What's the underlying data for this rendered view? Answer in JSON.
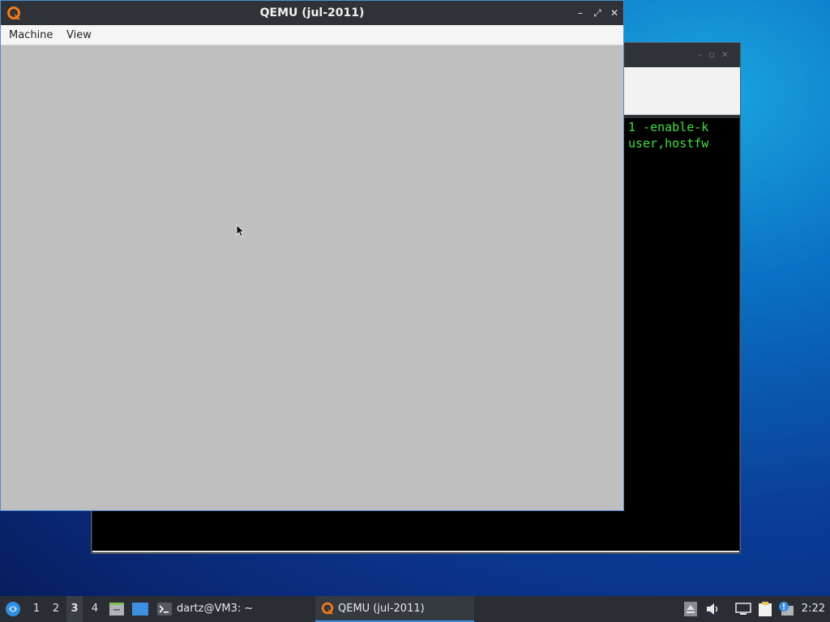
{
  "qemu": {
    "title": "QEMU (jul-2011)",
    "menu": [
      "Machine",
      "View"
    ],
    "controls": {
      "minimize": "–",
      "maximize": "⤢",
      "close": "✕"
    }
  },
  "terminal": {
    "lines": [
      "1 -enable-k",
      "user,hostfw"
    ]
  },
  "taskbar": {
    "workspaces": [
      "1",
      "2",
      "3",
      "4"
    ],
    "active_workspace": "3",
    "terminal_task": "dartz@VM3: ~",
    "qemu_task": "QEMU (jul-2011)",
    "clock": "2:22"
  },
  "icons": {
    "start": "lxqt-start-icon",
    "file_manager": "file-manager-icon",
    "desktop": "show-desktop-icon",
    "terminal": "terminal-icon",
    "qemu": "qemu-logo-icon",
    "eject": "eject-icon",
    "volume": "volume-icon",
    "network": "network-icon",
    "clipboard": "clipboard-icon",
    "notification": "notification-icon"
  },
  "colors": {
    "term_text": "#3fe13f",
    "accent": "#3d8fe0"
  }
}
